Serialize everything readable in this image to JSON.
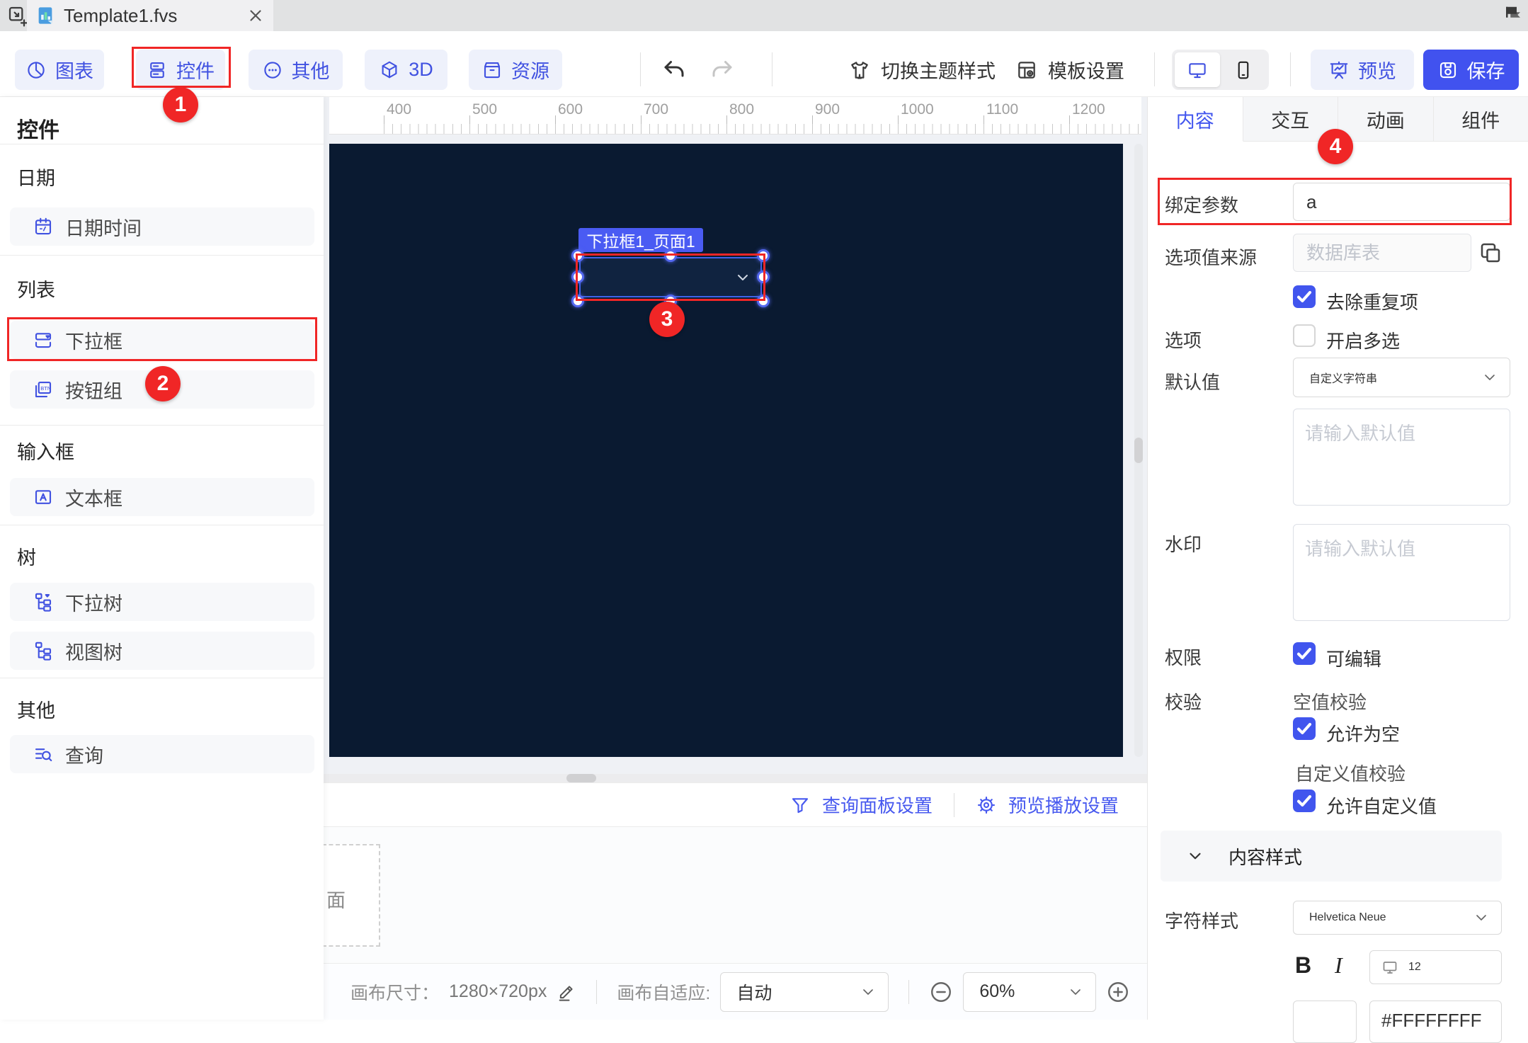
{
  "window": {
    "tab_title": "Template1.fvs"
  },
  "toolbar": {
    "nav_buttons": [
      {
        "label": "图表",
        "icon": "pie-chart-icon"
      },
      {
        "label": "控件",
        "icon": "widget-icon"
      },
      {
        "label": "其他",
        "icon": "more-circle-icon"
      },
      {
        "label": "3D",
        "icon": "cube-icon"
      },
      {
        "label": "资源",
        "icon": "resource-icon"
      }
    ],
    "theme_switch_label": "切换主题样式",
    "template_settings_label": "模板设置",
    "preview_label": "预览",
    "save_label": "保存"
  },
  "sidebar": {
    "title": "控件",
    "sections": [
      {
        "label": "日期",
        "items": [
          {
            "label": "日期时间"
          }
        ]
      },
      {
        "label": "列表",
        "items": [
          {
            "label": "下拉框"
          },
          {
            "label": "按钮组"
          }
        ]
      },
      {
        "label": "输入框",
        "items": [
          {
            "label": "文本框"
          }
        ]
      },
      {
        "label": "树",
        "items": [
          {
            "label": "下拉树"
          },
          {
            "label": "视图树"
          }
        ]
      },
      {
        "label": "其他",
        "items": [
          {
            "label": "查询"
          }
        ]
      }
    ]
  },
  "canvas": {
    "ruler_labels": [
      "400",
      "500",
      "600",
      "700",
      "800",
      "900",
      "1000",
      "1100",
      "1200"
    ],
    "selected_component_tag": "下拉框1_页面1",
    "page_thumbnail_text": "面",
    "footer": {
      "query_panel": "查询面板设置",
      "preview_play": "预览播放设置"
    },
    "statusbar": {
      "size_label": "画布尺寸：",
      "size_value": "1280×720px",
      "fit_label": "画布自适应:",
      "fit_value": "自动",
      "zoom_value": "60%"
    }
  },
  "inspector": {
    "tabs": [
      {
        "label": "内容"
      },
      {
        "label": "交互"
      },
      {
        "label": "动画"
      },
      {
        "label": "组件"
      }
    ],
    "rows": {
      "bind_param_label": "绑定参数",
      "bind_param_value": "a",
      "source_label": "选项值来源",
      "source_placeholder": "数据库表",
      "dedupe_label": "去除重复项",
      "options_label": "选项",
      "multi_label": "开启多选",
      "default_label": "默认值",
      "default_type": "自定义字符串",
      "default_placeholder": "请输入默认值",
      "watermark_label": "水印",
      "watermark_placeholder": "请输入默认值",
      "permission_label": "权限",
      "editable_label": "可编辑",
      "validation_label": "校验",
      "empty_check_title": "空值校验",
      "allow_empty_label": "允许为空",
      "custom_check_title": "自定义值校验",
      "allow_custom_label": "允许自定义值"
    },
    "content_style": {
      "title": "内容样式",
      "char_style_label": "字符样式",
      "font_name": "Helvetica Neue",
      "bold": "B",
      "italic": "I",
      "font_size": "12",
      "color_value": "#FFFFFFFF"
    }
  },
  "annotations": {
    "step_1": "1",
    "step_2": "2",
    "step_3": "3",
    "step_4": "4"
  },
  "colors": {
    "accent": "#4152ef",
    "annotation_red": "#f02626",
    "canvas_bg": "#0a1a31",
    "save_button": "#4152ef"
  }
}
